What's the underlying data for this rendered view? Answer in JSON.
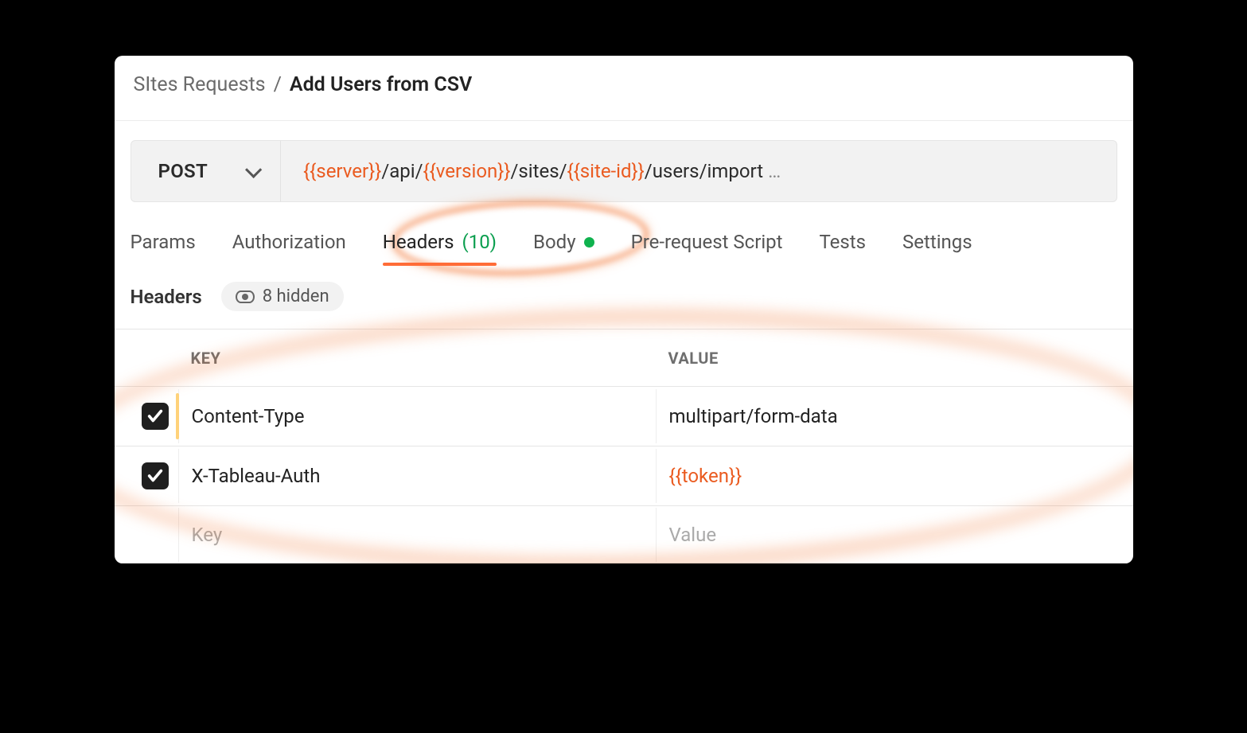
{
  "breadcrumb": {
    "parent": "SItes Requests",
    "separator": "/",
    "title": "Add Users from CSV"
  },
  "request": {
    "method": "POST",
    "url_parts": [
      {
        "type": "var",
        "text": "{{server}}"
      },
      {
        "type": "text",
        "text": "/api/"
      },
      {
        "type": "var",
        "text": "{{version}}"
      },
      {
        "type": "text",
        "text": "/sites/"
      },
      {
        "type": "var",
        "text": "{{site-id}}"
      },
      {
        "type": "text",
        "text": "/users/import"
      }
    ],
    "truncated": "…"
  },
  "tabs": {
    "params": "Params",
    "auth": "Authorization",
    "headers_label": "Headers",
    "headers_count": "(10)",
    "body": "Body",
    "prereq": "Pre-request Script",
    "tests": "Tests",
    "settings": "Settings"
  },
  "sub": {
    "label": "Headers",
    "hidden_text": "8 hidden"
  },
  "columns": {
    "key": "KEY",
    "value": "VALUE"
  },
  "rows": [
    {
      "enabled": true,
      "key": "Content-Type",
      "value": "multipart/form-data",
      "value_is_var": false
    },
    {
      "enabled": true,
      "key": "X-Tableau-Auth",
      "value": "{{token}}",
      "value_is_var": true
    }
  ],
  "placeholder": {
    "key": "Key",
    "value": "Value"
  }
}
